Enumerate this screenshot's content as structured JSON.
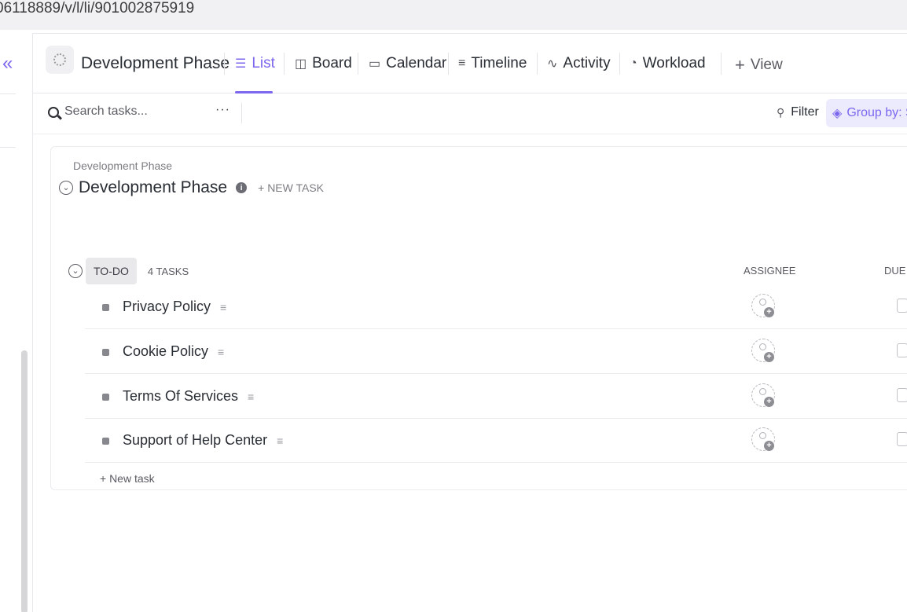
{
  "url": "06118889/v/l/li/901002875919",
  "sidebar": {
    "collapse_icon": "double-chevron-left-icon"
  },
  "header": {
    "title": "Development Phase",
    "tabs": [
      {
        "label": "List",
        "icon": "list-icon"
      },
      {
        "label": "Board",
        "icon": "board-icon"
      },
      {
        "label": "Calendar",
        "icon": "calendar-icon"
      },
      {
        "label": "Timeline",
        "icon": "timeline-icon"
      },
      {
        "label": "Activity",
        "icon": "activity-icon"
      },
      {
        "label": "Workload",
        "icon": "workload-icon"
      }
    ],
    "active_tab": "List",
    "add_view_label": "View"
  },
  "toolbar": {
    "search_placeholder": "Search tasks...",
    "more_label": "···",
    "filter_label": "Filter",
    "group_label": "Group by: Sta"
  },
  "list": {
    "breadcrumb": "Development Phase",
    "title": "Development Phase",
    "new_task_label": "+ NEW TASK",
    "group": {
      "status": "TO-DO",
      "count_label": "4 TASKS",
      "col_assignee": "ASSIGNEE",
      "col_due": "DUE D"
    },
    "tasks": [
      {
        "name": "Privacy Policy"
      },
      {
        "name": "Cookie Policy"
      },
      {
        "name": "Terms Of Services"
      },
      {
        "name": "Support of Help Center"
      }
    ],
    "new_task_bottom": "+ New task"
  },
  "colors": {
    "accent": "#7b68ee",
    "text": "#292d34",
    "muted": "#7c7d83"
  }
}
